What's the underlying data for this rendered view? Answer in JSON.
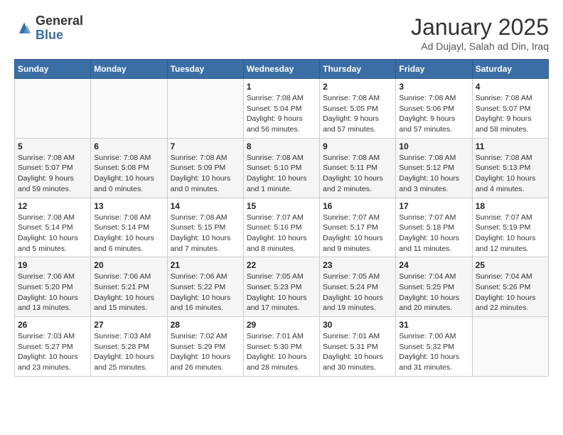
{
  "header": {
    "logo_line1": "General",
    "logo_line2": "Blue",
    "title": "January 2025",
    "subtitle": "Ad Dujayl, Salah ad Din, Iraq"
  },
  "weekdays": [
    "Sunday",
    "Monday",
    "Tuesday",
    "Wednesday",
    "Thursday",
    "Friday",
    "Saturday"
  ],
  "weeks": [
    [
      {
        "day": "",
        "info": ""
      },
      {
        "day": "",
        "info": ""
      },
      {
        "day": "",
        "info": ""
      },
      {
        "day": "1",
        "info": "Sunrise: 7:08 AM\nSunset: 5:04 PM\nDaylight: 9 hours and 56 minutes."
      },
      {
        "day": "2",
        "info": "Sunrise: 7:08 AM\nSunset: 5:05 PM\nDaylight: 9 hours and 57 minutes."
      },
      {
        "day": "3",
        "info": "Sunrise: 7:08 AM\nSunset: 5:06 PM\nDaylight: 9 hours and 57 minutes."
      },
      {
        "day": "4",
        "info": "Sunrise: 7:08 AM\nSunset: 5:07 PM\nDaylight: 9 hours and 58 minutes."
      }
    ],
    [
      {
        "day": "5",
        "info": "Sunrise: 7:08 AM\nSunset: 5:07 PM\nDaylight: 9 hours and 59 minutes."
      },
      {
        "day": "6",
        "info": "Sunrise: 7:08 AM\nSunset: 5:08 PM\nDaylight: 10 hours and 0 minutes."
      },
      {
        "day": "7",
        "info": "Sunrise: 7:08 AM\nSunset: 5:09 PM\nDaylight: 10 hours and 0 minutes."
      },
      {
        "day": "8",
        "info": "Sunrise: 7:08 AM\nSunset: 5:10 PM\nDaylight: 10 hours and 1 minute."
      },
      {
        "day": "9",
        "info": "Sunrise: 7:08 AM\nSunset: 5:11 PM\nDaylight: 10 hours and 2 minutes."
      },
      {
        "day": "10",
        "info": "Sunrise: 7:08 AM\nSunset: 5:12 PM\nDaylight: 10 hours and 3 minutes."
      },
      {
        "day": "11",
        "info": "Sunrise: 7:08 AM\nSunset: 5:13 PM\nDaylight: 10 hours and 4 minutes."
      }
    ],
    [
      {
        "day": "12",
        "info": "Sunrise: 7:08 AM\nSunset: 5:14 PM\nDaylight: 10 hours and 5 minutes."
      },
      {
        "day": "13",
        "info": "Sunrise: 7:08 AM\nSunset: 5:14 PM\nDaylight: 10 hours and 6 minutes."
      },
      {
        "day": "14",
        "info": "Sunrise: 7:08 AM\nSunset: 5:15 PM\nDaylight: 10 hours and 7 minutes."
      },
      {
        "day": "15",
        "info": "Sunrise: 7:07 AM\nSunset: 5:16 PM\nDaylight: 10 hours and 8 minutes."
      },
      {
        "day": "16",
        "info": "Sunrise: 7:07 AM\nSunset: 5:17 PM\nDaylight: 10 hours and 9 minutes."
      },
      {
        "day": "17",
        "info": "Sunrise: 7:07 AM\nSunset: 5:18 PM\nDaylight: 10 hours and 11 minutes."
      },
      {
        "day": "18",
        "info": "Sunrise: 7:07 AM\nSunset: 5:19 PM\nDaylight: 10 hours and 12 minutes."
      }
    ],
    [
      {
        "day": "19",
        "info": "Sunrise: 7:06 AM\nSunset: 5:20 PM\nDaylight: 10 hours and 13 minutes."
      },
      {
        "day": "20",
        "info": "Sunrise: 7:06 AM\nSunset: 5:21 PM\nDaylight: 10 hours and 15 minutes."
      },
      {
        "day": "21",
        "info": "Sunrise: 7:06 AM\nSunset: 5:22 PM\nDaylight: 10 hours and 16 minutes."
      },
      {
        "day": "22",
        "info": "Sunrise: 7:05 AM\nSunset: 5:23 PM\nDaylight: 10 hours and 17 minutes."
      },
      {
        "day": "23",
        "info": "Sunrise: 7:05 AM\nSunset: 5:24 PM\nDaylight: 10 hours and 19 minutes."
      },
      {
        "day": "24",
        "info": "Sunrise: 7:04 AM\nSunset: 5:25 PM\nDaylight: 10 hours and 20 minutes."
      },
      {
        "day": "25",
        "info": "Sunrise: 7:04 AM\nSunset: 5:26 PM\nDaylight: 10 hours and 22 minutes."
      }
    ],
    [
      {
        "day": "26",
        "info": "Sunrise: 7:03 AM\nSunset: 5:27 PM\nDaylight: 10 hours and 23 minutes."
      },
      {
        "day": "27",
        "info": "Sunrise: 7:03 AM\nSunset: 5:28 PM\nDaylight: 10 hours and 25 minutes."
      },
      {
        "day": "28",
        "info": "Sunrise: 7:02 AM\nSunset: 5:29 PM\nDaylight: 10 hours and 26 minutes."
      },
      {
        "day": "29",
        "info": "Sunrise: 7:01 AM\nSunset: 5:30 PM\nDaylight: 10 hours and 28 minutes."
      },
      {
        "day": "30",
        "info": "Sunrise: 7:01 AM\nSunset: 5:31 PM\nDaylight: 10 hours and 30 minutes."
      },
      {
        "day": "31",
        "info": "Sunrise: 7:00 AM\nSunset: 5:32 PM\nDaylight: 10 hours and 31 minutes."
      },
      {
        "day": "",
        "info": ""
      }
    ]
  ]
}
